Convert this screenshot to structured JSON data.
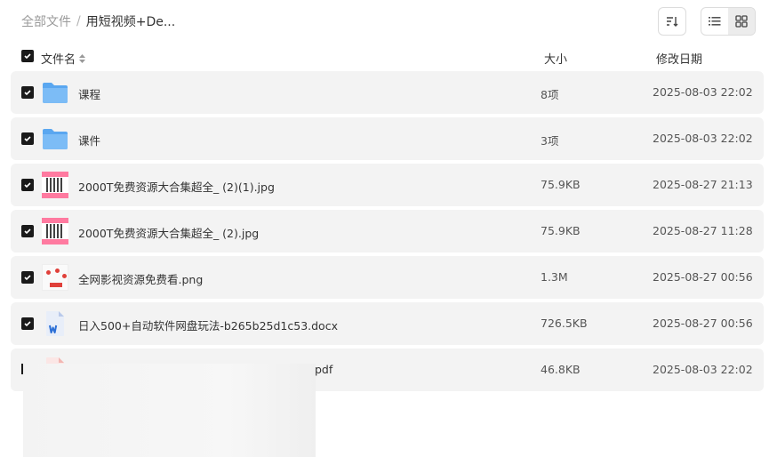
{
  "breadcrumb": {
    "root": "全部文件",
    "separator": "/",
    "current": "用短视频+De..."
  },
  "header": {
    "name": "文件名",
    "size": "大小",
    "date": "修改日期"
  },
  "rows": [
    {
      "name": "课程",
      "size": "8项",
      "date": "2025-08-03 22:02",
      "type": "folder",
      "checked": true
    },
    {
      "name": "课件",
      "size": "3项",
      "date": "2025-08-03 22:02",
      "type": "folder",
      "checked": true
    },
    {
      "name": "2000T免费资源大合集超全_ (2)(1).jpg",
      "size": "75.9KB",
      "date": "2025-08-27 21:13",
      "type": "qr-image",
      "checked": true
    },
    {
      "name": "2000T免费资源大合集超全_ (2).jpg",
      "size": "75.9KB",
      "date": "2025-08-27 11:28",
      "type": "qr-image",
      "checked": true
    },
    {
      "name": "全网影视资源免费看.png",
      "size": "1.3M",
      "date": "2025-08-27 00:56",
      "type": "png-image",
      "checked": true
    },
    {
      "name": "日入500+自动软件网盘玩法-b265b25d1c53.docx",
      "size": "726.5KB",
      "date": "2025-08-27 00:56",
      "type": "word-doc",
      "checked": true
    },
    {
      "name": "pdf",
      "size": "46.8KB",
      "date": "2025-08-03 22:02",
      "type": "pdf-doc",
      "checked": false
    }
  ],
  "colors": {
    "row_bg": "#f3f3f3",
    "checkbox": "#1a1a1a",
    "folder": "#5aa7f0",
    "word": "#2b6fd6",
    "pdf": "#e8534a"
  }
}
